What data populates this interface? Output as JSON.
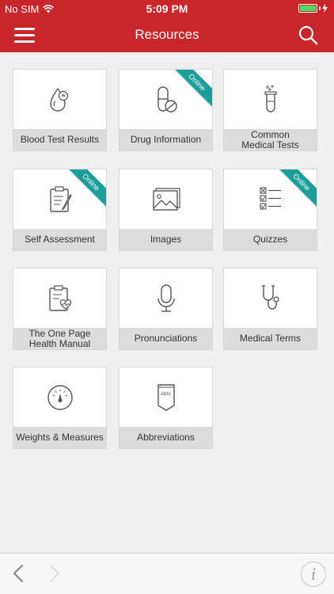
{
  "status": {
    "carrier": "No SIM",
    "time": "5:09 PM"
  },
  "nav": {
    "title": "Resources"
  },
  "tiles": [
    {
      "label": "Blood Test Results",
      "icon": "blood-drop-icon",
      "online": false
    },
    {
      "label": "Drug Information",
      "icon": "pill-icon",
      "online": true
    },
    {
      "label": "Common Medical Tests",
      "icon": "test-tube-icon",
      "online": false
    },
    {
      "label": "Self Assessment",
      "icon": "clipboard-pen-icon",
      "online": true
    },
    {
      "label": "Images",
      "icon": "images-icon",
      "online": false
    },
    {
      "label": "Quizzes",
      "icon": "checklist-icon",
      "online": true
    },
    {
      "label": "The One Page Health Manual",
      "icon": "clipboard-heart-icon",
      "online": false
    },
    {
      "label": "Pronunciations",
      "icon": "microphone-icon",
      "online": false
    },
    {
      "label": "Medical Terms",
      "icon": "stethoscope-icon",
      "online": false
    },
    {
      "label": "Weights & Measures",
      "icon": "gauge-icon",
      "online": false
    },
    {
      "label": "Abbreviations",
      "icon": "abbr-tag-icon",
      "online": false
    }
  ],
  "ribbon_label": "Online",
  "info_label": "i",
  "colors": {
    "brand": "#c8262b",
    "ribbon": "#1b9e9a"
  }
}
